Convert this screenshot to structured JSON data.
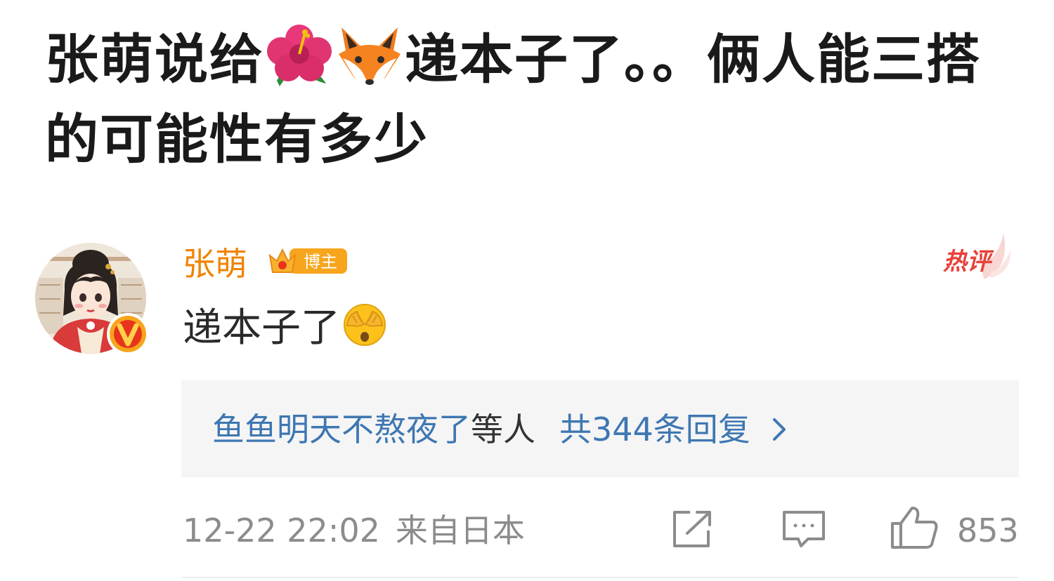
{
  "post": {
    "title_part1": "张萌说给",
    "title_part2": "递本子了。。俩人能三搭的可能性有多少",
    "title_emojis": [
      "hibiscus-icon",
      "fox-icon"
    ]
  },
  "comment": {
    "username": "张萌",
    "blogger_badge": "博主",
    "hot_badge": "热评",
    "text": "递本子了",
    "text_emoji": "face-covering-eyes-icon",
    "reply_names": "鱼鱼明天不熬夜了",
    "reply_suffix": "等人",
    "reply_count_text": "共344条回复",
    "time": "12-22 22:02",
    "source": "来自日本",
    "like_count": "853"
  },
  "colors": {
    "username": "#f08300",
    "link_blue": "#3e77b2",
    "hot_red": "#e8413a",
    "muted": "#8c8c8c"
  }
}
